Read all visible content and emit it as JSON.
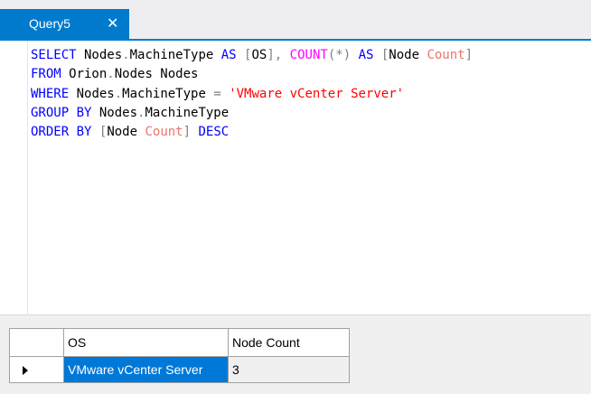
{
  "tab": {
    "title": "Query5",
    "close_glyph": "✕"
  },
  "editor": {
    "line1": {
      "select": "SELECT",
      "t1": " Nodes",
      "dot1": ".",
      "t2": "MachineType ",
      "as1": "AS",
      "sp1": " ",
      "lb1": "[",
      "os": "OS",
      "rb1": "]",
      "comma": ",",
      "sp2": " ",
      "count": "COUNT",
      "lp": "(",
      "star": "*",
      "rp": ")",
      "sp3": " ",
      "as2": "AS",
      "sp4": " ",
      "lb2": "[",
      "node": "Node",
      "sp5": " ",
      "cnt": "Count",
      "rb2": "]"
    },
    "line2": {
      "from": "FROM",
      "t1": " Orion",
      "dot": ".",
      "t2": "Nodes Nodes"
    },
    "line3": {
      "where": "WHERE",
      "t1": " Nodes",
      "dot": ".",
      "t2": "MachineType ",
      "eq": "=",
      "sp": " ",
      "str": "'VMware vCenter Server'"
    },
    "line4": {
      "group": "GROUP BY",
      "t1": " Nodes",
      "dot": ".",
      "t2": "MachineType"
    },
    "line5": {
      "order": "ORDER BY",
      "sp": " ",
      "lb": "[",
      "node": "Node",
      "sp2": " ",
      "cnt": "Count",
      "rb": "]",
      "sp3": " ",
      "desc": "DESC"
    }
  },
  "results": {
    "columns": [
      "OS",
      "Node Count"
    ],
    "rows": [
      {
        "os": "VMware vCenter Server",
        "node_count": "3"
      }
    ]
  }
}
